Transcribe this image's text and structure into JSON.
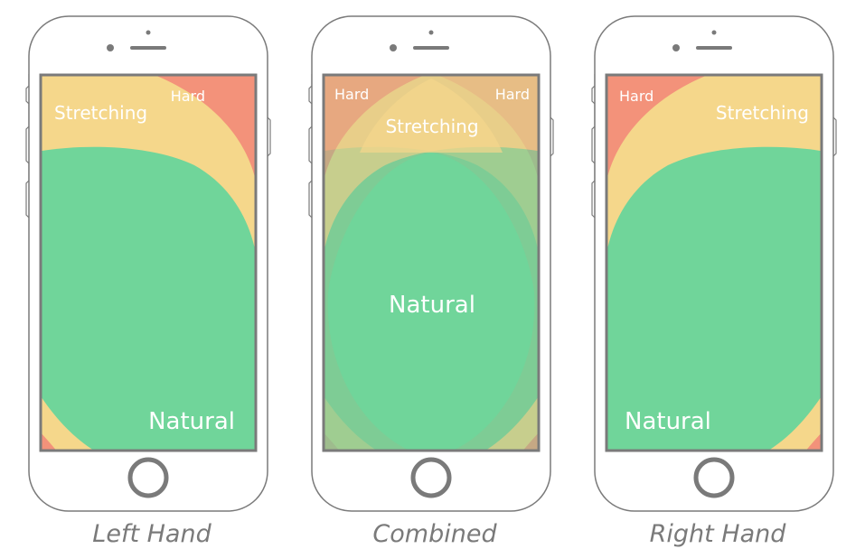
{
  "colors": {
    "natural": "#70d59a",
    "stretching": "#f5d78b",
    "hard": "#f3927a",
    "frame": "#7a7a7a",
    "caption": "#7a7a7a"
  },
  "phones": [
    {
      "id": "left",
      "caption": "Left Hand",
      "labels": {
        "hard": "Hard",
        "stretching": "Stretching",
        "natural": "Natural"
      }
    },
    {
      "id": "combined",
      "caption": "Combined",
      "labels": {
        "hard_left": "Hard",
        "hard_right": "Hard",
        "stretching": "Stretching",
        "natural": "Natural"
      }
    },
    {
      "id": "right",
      "caption": "Right Hand",
      "labels": {
        "hard": "Hard",
        "stretching": "Stretching",
        "natural": "Natural"
      }
    }
  ]
}
